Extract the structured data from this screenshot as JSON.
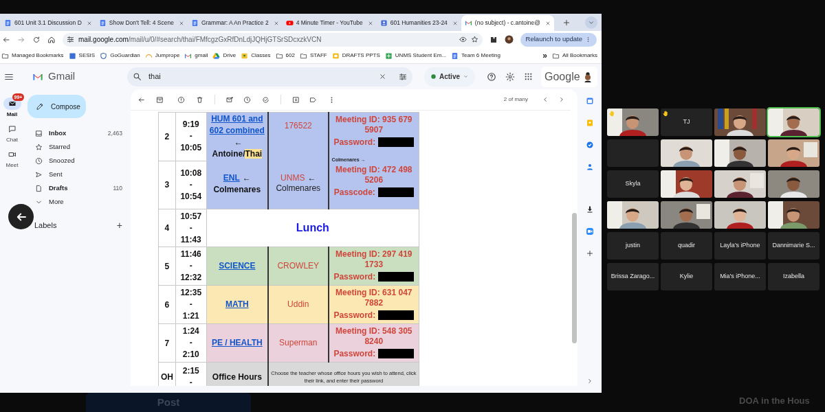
{
  "browser": {
    "tabs": [
      {
        "kind": "doc",
        "title": "601 Unit 3.1 Discussion D",
        "selected": false
      },
      {
        "kind": "doc",
        "title": "Show Don't Tell: 4 Scene",
        "selected": false
      },
      {
        "kind": "doc",
        "title": "Grammar: A An Practice 2",
        "selected": false
      },
      {
        "kind": "video",
        "title": "4 Minute Timer - YouTube",
        "selected": false
      },
      {
        "kind": "roster",
        "title": "601 Humanities 23-24",
        "selected": false
      },
      {
        "kind": "mail",
        "title": "(no subject) - c.antoine@",
        "selected": true
      }
    ],
    "url_domain": "mail.google.com",
    "url_path": "/mail/u/0/#search/thai/FMfcgzGxRfDnLdjJQHjGTSrSDcxzkVCN",
    "relaunch": "Relaunch to update",
    "bookmarks": [
      {
        "kind": "folder",
        "label": "Managed Bookmarks"
      },
      {
        "kind": "sesis",
        "label": "SESIS"
      },
      {
        "kind": "shield",
        "label": "GoGuardian"
      },
      {
        "kind": "arc",
        "label": "Jumprope"
      },
      {
        "kind": "mail",
        "label": "gmail"
      },
      {
        "kind": "drive",
        "label": "Drive"
      },
      {
        "kind": "classes",
        "label": "Classes"
      },
      {
        "kind": "folder",
        "label": "602"
      },
      {
        "kind": "folder",
        "label": "STAFF"
      },
      {
        "kind": "slides",
        "label": "DRAFTS PPTS"
      },
      {
        "kind": "sheet",
        "label": "UNMS Student Em..."
      },
      {
        "kind": "doc",
        "label": "Team 6 Meeting"
      }
    ],
    "more_bookmarks": "»",
    "all_bookmarks": "All Bookmarks"
  },
  "gmail": {
    "logo": "Gmail",
    "search": "thai",
    "status": "Active",
    "account": "Google",
    "rail": [
      {
        "kind": "mail",
        "label": "Mail",
        "badge": "99+",
        "selected": true
      },
      {
        "kind": "chat",
        "label": "Chat",
        "selected": false
      },
      {
        "kind": "meet",
        "label": "Meet",
        "selected": false
      }
    ],
    "compose": "Compose",
    "nav": [
      {
        "kind": "inbox",
        "label": "Inbox",
        "count": "2,463",
        "unread": true
      },
      {
        "kind": "star",
        "label": "Starred",
        "unread": false
      },
      {
        "kind": "clock",
        "label": "Snoozed",
        "unread": false
      },
      {
        "kind": "send",
        "label": "Sent",
        "unread": false
      },
      {
        "kind": "draft",
        "label": "Drafts",
        "count": "110",
        "unread": true
      },
      {
        "kind": "more",
        "label": "More",
        "unread": false
      }
    ],
    "labels": "Labels",
    "labels_add": "+",
    "pager": "2 of many"
  },
  "schedule": {
    "blocks": [
      {
        "kind": "class",
        "color": "#b4c4ef",
        "periods": [
          {
            "period": "2",
            "time": [
              "9:19",
              "-",
              "10:05"
            ],
            "link": "HUM 601 and 602 combined",
            "arrow": "←",
            "teacher": "Antoine/",
            "highlight": "Thai"
          },
          {
            "period": "3",
            "time": [
              "10:08",
              "-",
              "10:54"
            ],
            "link": "ENL",
            "arrow": "←",
            "teacher": "Colmenares"
          }
        ],
        "teacher_lines": [
          {
            "kind": "code",
            "text": "176522"
          },
          {
            "kind": "room",
            "text": "UNMS",
            "arrow": "←"
          },
          {
            "kind": "name",
            "text": "Colmenares"
          }
        ],
        "meeting": [
          {
            "kind": "id",
            "text": "**Meeting ID:** 935 679 5907"
          },
          {
            "kind": "password",
            "text": "Password:"
          },
          {
            "kind": "note",
            "text": "Colmenares →"
          },
          {
            "kind": "id",
            "text": "**Meeting ID:** 472 498 5206"
          },
          {
            "kind": "password",
            "text": "Passcode:"
          }
        ]
      },
      {
        "kind": "lunch",
        "periods": [
          {
            "period": "4",
            "time": [
              "10:57",
              "-",
              "11:43"
            ]
          }
        ],
        "label": "Lunch"
      },
      {
        "kind": "class",
        "color": "#c9dfc0",
        "periods": [
          {
            "period": "5",
            "time": [
              "11:46",
              "-",
              "12:32"
            ],
            "link": "SCIENCE"
          }
        ],
        "teacher_lines": [
          {
            "kind": "code",
            "text": "CROWLEY"
          }
        ],
        "meeting": [
          {
            "kind": "id",
            "text": "**Meeting ID:** 297 419 1733"
          },
          {
            "kind": "password",
            "text": "Password:"
          }
        ]
      },
      {
        "kind": "class",
        "color": "#fce8b2",
        "periods": [
          {
            "period": "6",
            "time": [
              "12:35",
              "-",
              "1:21"
            ],
            "link": "MATH"
          }
        ],
        "teacher_lines": [
          {
            "kind": "code",
            "text": "Uddin"
          }
        ],
        "meeting": [
          {
            "kind": "id",
            "text": "**Meeting ID:**  631 047 7882"
          },
          {
            "kind": "password",
            "text": "Password:"
          }
        ]
      },
      {
        "kind": "class",
        "color": "#ead1dc",
        "periods": [
          {
            "period": "7",
            "time": [
              "1:24",
              "-",
              "2:10"
            ],
            "link": "PE / HEALTH"
          }
        ],
        "teacher_lines": [
          {
            "kind": "code",
            "text": "Superman"
          }
        ],
        "meeting": [
          {
            "kind": "id",
            "text": "**Meeting ID:**  548 305 8240"
          },
          {
            "kind": "password",
            "text": "Password:"
          }
        ]
      },
      {
        "kind": "office",
        "color": "#d9d9d9",
        "periods": [
          {
            "period": "OH",
            "time": [
              "2:15",
              "-"
            ]
          }
        ],
        "label": "Office Hours",
        "note": "Choose the teacher whose office hours you wish to attend, click their link, and enter their password"
      }
    ]
  },
  "meeting_grid": [
    {
      "kind": "video",
      "hand_raised": true,
      "speaking": false
    },
    {
      "kind": "name",
      "name": "TJ",
      "hand_raised": true,
      "speaking": false
    },
    {
      "kind": "video",
      "hand_raised": false,
      "speaking": false
    },
    {
      "kind": "video",
      "hand_raised": false,
      "speaking": true
    },
    {
      "kind": "blank",
      "hand_raised": false,
      "speaking": false
    },
    {
      "kind": "video",
      "hand_raised": false,
      "speaking": false
    },
    {
      "kind": "video",
      "hand_raised": false,
      "speaking": false
    },
    {
      "kind": "video",
      "hand_raised": false,
      "speaking": false
    },
    {
      "kind": "name",
      "name": "Skyla",
      "hand_raised": false,
      "speaking": false
    },
    {
      "kind": "video",
      "hand_raised": false,
      "speaking": false
    },
    {
      "kind": "video",
      "hand_raised": false,
      "speaking": false
    },
    {
      "kind": "video",
      "hand_raised": false,
      "speaking": false
    },
    {
      "kind": "video",
      "hand_raised": false,
      "speaking": false
    },
    {
      "kind": "video",
      "hand_raised": false,
      "speaking": false
    },
    {
      "kind": "video",
      "hand_raised": false,
      "speaking": false
    },
    {
      "kind": "video",
      "hand_raised": false,
      "speaking": false
    },
    {
      "kind": "name",
      "name": "justin",
      "hand_raised": false,
      "speaking": false
    },
    {
      "kind": "name",
      "name": "quadir",
      "hand_raised": false,
      "speaking": false
    },
    {
      "kind": "name",
      "name": "Layla's iPhone",
      "hand_raised": false,
      "speaking": false
    },
    {
      "kind": "name",
      "name": "Dannimarie S...",
      "hand_raised": false,
      "speaking": false
    },
    {
      "kind": "name",
      "name": "Brissa Zarago...",
      "hand_raised": false,
      "speaking": false
    },
    {
      "kind": "name",
      "name": "Kylie",
      "hand_raised": false,
      "speaking": false
    },
    {
      "kind": "name",
      "name": "Mia's iPhone...",
      "hand_raised": false,
      "speaking": false
    },
    {
      "kind": "name",
      "name": "Izabella",
      "hand_raised": false,
      "speaking": false
    }
  ],
  "background": {
    "post_button": "Post",
    "side_title": "DOA in the Hous"
  }
}
